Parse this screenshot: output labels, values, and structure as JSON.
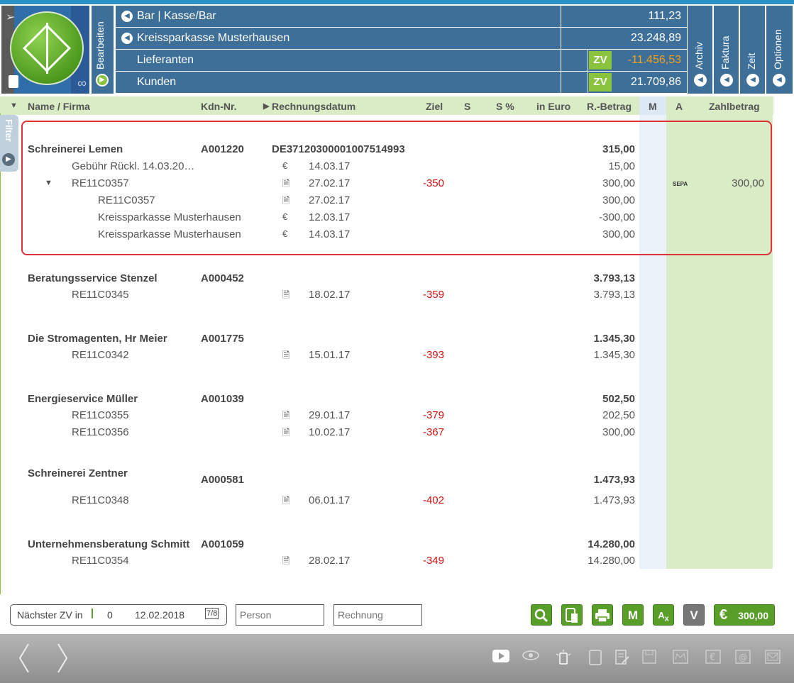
{
  "header": {
    "bearbeiten_label": "Bearbeiten",
    "accounts": [
      {
        "name": "Bar | Kasse/Bar",
        "value": "111,23",
        "zv": ""
      },
      {
        "name": "Kreissparkasse Musterhausen",
        "value": "23.248,89",
        "zv": ""
      },
      {
        "name": "Lieferanten",
        "value": "-11.456,53",
        "zv": "ZV"
      },
      {
        "name": "Kunden",
        "value": "21.709,86",
        "zv": "ZV"
      }
    ],
    "tabs": [
      "Archiv",
      "Faktura",
      "Zeit",
      "Optionen"
    ]
  },
  "columns": {
    "name": "Name / Firma",
    "kdn": "Kdn-Nr.",
    "datum": "Rechnungsdatum",
    "ziel": "Ziel",
    "s": "S",
    "s_pct": "S %",
    "in_euro": "in Euro",
    "betrag": "R.-Betrag",
    "m": "M",
    "a": "A",
    "zahlbetrag": "Zahlbetrag"
  },
  "filter_label": "Filter",
  "customers": [
    {
      "name": "Schreinerei Lemen",
      "kdn": "A001220",
      "iban": "DE37120300001007514993",
      "total": "315,00",
      "items": [
        {
          "label": "Gebühr Rückl. 14.03.20…",
          "icon": "€",
          "date": "14.03.17",
          "ziel": "",
          "betrag": "15,00"
        },
        {
          "label": "RE11C0357",
          "icon": "🗎",
          "date": "27.02.17",
          "ziel": "-350",
          "betrag": "300,00",
          "sepa": "SEPA",
          "zahlbetrag": "300,00"
        },
        {
          "label": "RE11C0357",
          "icon": "🗎",
          "date": "27.02.17",
          "ziel": "",
          "betrag": "300,00"
        },
        {
          "label": "Kreissparkasse Musterhausen",
          "icon": "€",
          "date": "12.03.17",
          "ziel": "",
          "betrag": "-300,00"
        },
        {
          "label": "Kreissparkasse Musterhausen",
          "icon": "€",
          "date": "14.03.17",
          "ziel": "",
          "betrag": "300,00"
        }
      ]
    },
    {
      "name": "Beratungsservice Stenzel",
      "kdn": "A000452",
      "total": "3.793,13",
      "items": [
        {
          "label": "RE11C0345",
          "icon": "🗎",
          "date": "18.02.17",
          "ziel": "-359",
          "betrag": "3.793,13"
        }
      ]
    },
    {
      "name": "Die Stromagenten, Hr Meier",
      "kdn": "A001775",
      "total": "1.345,30",
      "items": [
        {
          "label": "RE11C0342",
          "icon": "🗎",
          "date": "15.01.17",
          "ziel": "-393",
          "betrag": "1.345,30"
        }
      ]
    },
    {
      "name": "Energieservice Müller",
      "kdn": "A001039",
      "total": "502,50",
      "items": [
        {
          "label": "RE11C0355",
          "icon": "🗎",
          "date": "29.01.17",
          "ziel": "-379",
          "betrag": "202,50"
        },
        {
          "label": "RE11C0356",
          "icon": "🗎",
          "date": "10.02.17",
          "ziel": "-367",
          "betrag": "300,00"
        }
      ]
    },
    {
      "name": "Schreinerei Zentner",
      "kdn": "A000581",
      "total": "1.473,93",
      "items": [
        {
          "label": "RE11C0348",
          "icon": "🗎",
          "date": "06.01.17",
          "ziel": "-402",
          "betrag": "1.473,93"
        }
      ]
    },
    {
      "name": "Unternehmensberatung Schmitt",
      "kdn": "A001059",
      "total": "14.280,00",
      "items": [
        {
          "label": "RE11C0354",
          "icon": "🗎",
          "date": "28.02.17",
          "ziel": "-349",
          "betrag": "14.280,00"
        }
      ]
    }
  ],
  "footer": {
    "next_zv_label": "Nächster ZV in",
    "next_zv_count": "0",
    "next_zv_date": "12.02.2018",
    "person_placeholder": "Person",
    "rechnung_placeholder": "Rechnung",
    "m_label": "M",
    "v_label": "V",
    "total_currency": "€",
    "total_value": "300,00"
  },
  "colors": {
    "header_blue": "#3d6f98",
    "accent_green": "#8ac43f",
    "negative_orange": "#f0a020",
    "negative_red": "#d01010"
  }
}
